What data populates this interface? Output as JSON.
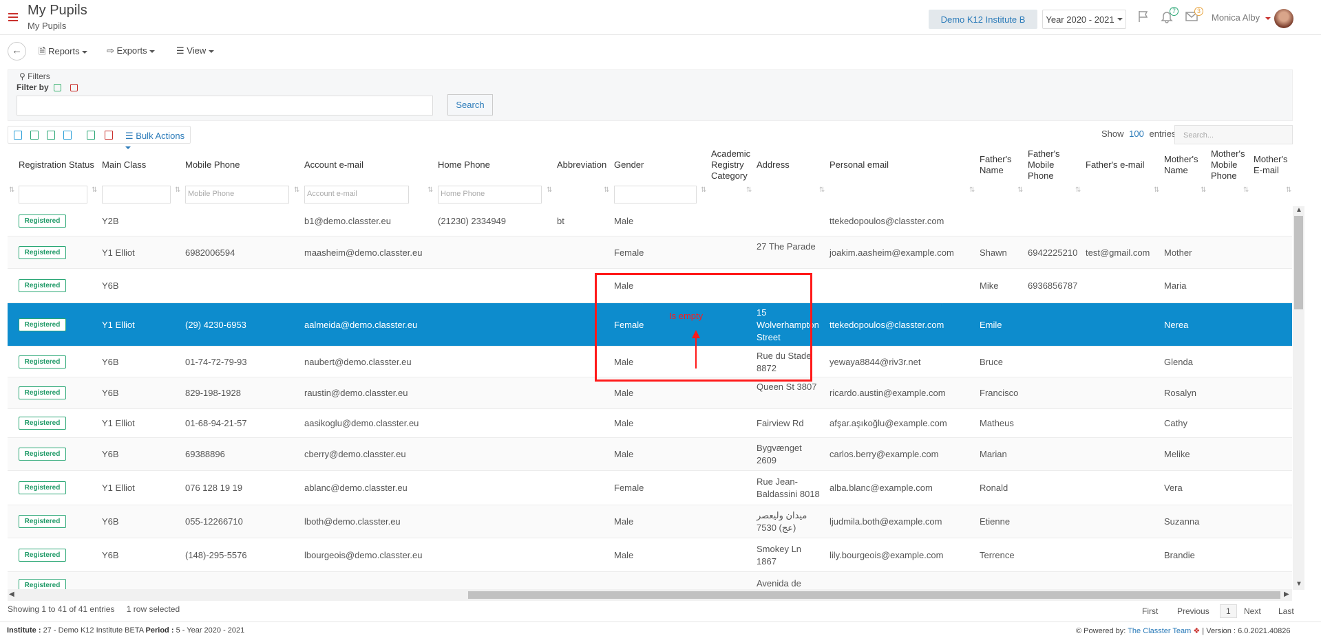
{
  "header": {
    "title": "My Pupils",
    "subtitle": "My Pupils",
    "institute": "Demo K12 Institute B",
    "year": "Year 2020 - 2021",
    "notifications_count": "7",
    "messages_count": "3",
    "user_name": "Monica Alby"
  },
  "toolbar": {
    "reports": "Reports",
    "exports": "Exports",
    "view": "View"
  },
  "filters": {
    "label": "Filters",
    "filter_by": "Filter by",
    "search_button": "Search"
  },
  "table_controls": {
    "bulk_actions": "Bulk Actions",
    "show_label": "Show",
    "entries_value": "100",
    "entries_label": "entries",
    "search_placeholder": "Search..."
  },
  "columns": {
    "registration_status": "Registration Status",
    "main_class": "Main Class",
    "mobile_phone": "Mobile Phone",
    "account_email": "Account e-mail",
    "home_phone": "Home Phone",
    "abbreviation": "Abbreviation",
    "gender": "Gender",
    "academic_registry_category": "Academic Registry Category",
    "address": "Address",
    "personal_email": "Personal email",
    "fathers_name": "Father's Name",
    "fathers_mobile_phone": "Father's Mobile Phone",
    "fathers_email": "Father's e-mail",
    "mothers_name": "Mother's Name",
    "mothers_mobile_phone": "Mother's Mobile Phone",
    "mothers_email": "Mother's E-mail"
  },
  "column_filters": {
    "mobile_phone_placeholder": "Mobile Phone",
    "account_email_placeholder": "Account e-mail",
    "home_phone_placeholder": "Home Phone"
  },
  "rows": [
    {
      "status": "Registered",
      "main_class": "Y2B",
      "mobile": "",
      "email": "b1@demo.classter.eu",
      "home_phone": "(21230) 2334949",
      "abbr": "bt",
      "gender": "Male",
      "address": "",
      "personal_email": "ttekedopoulos@classter.com",
      "father": "",
      "father_mobile": "",
      "father_email": "",
      "mother": ""
    },
    {
      "status": "Registered",
      "main_class": "Y1 Elliot",
      "mobile": "6982006594",
      "email": "maasheim@demo.classter.eu",
      "home_phone": "",
      "abbr": "",
      "gender": "Female",
      "address": "27 The Parade",
      "personal_email": "joakim.aasheim@example.com",
      "father": "Shawn",
      "father_mobile": "6942225210",
      "father_email": "test@gmail.com",
      "mother": "Mother"
    },
    {
      "status": "Registered",
      "main_class": "Y6B",
      "mobile": "",
      "email": "",
      "home_phone": "",
      "abbr": "",
      "gender": "Male",
      "address": "",
      "personal_email": "",
      "father": "Mike",
      "father_mobile": "6936856787",
      "father_email": "",
      "mother": "Maria"
    },
    {
      "status": "Registered",
      "main_class": "Y1 Elliot",
      "mobile": "(29) 4230-6953",
      "email": "aalmeida@demo.classter.eu",
      "home_phone": "",
      "abbr": "",
      "gender": "Female",
      "address": "15 Wolverhampton Street",
      "personal_email": "ttekedopoulos@classter.com",
      "father": "Emile",
      "father_mobile": "",
      "father_email": "",
      "mother": "Nerea"
    },
    {
      "status": "Registered",
      "main_class": "Y6B",
      "mobile": "01-74-72-79-93",
      "email": "naubert@demo.classter.eu",
      "home_phone": "",
      "abbr": "",
      "gender": "Male",
      "address": "Rue du Stade 8872",
      "personal_email": "yewaya8844@riv3r.net",
      "father": "Bruce",
      "father_mobile": "",
      "father_email": "",
      "mother": "Glenda"
    },
    {
      "status": "Registered",
      "main_class": "Y6B",
      "mobile": "829-198-1928",
      "email": "raustin@demo.classter.eu",
      "home_phone": "",
      "abbr": "",
      "gender": "Male",
      "address": "Queen St 3807",
      "personal_email": "ricardo.austin@example.com",
      "father": "Francisco",
      "father_mobile": "",
      "father_email": "",
      "mother": "Rosalyn"
    },
    {
      "status": "Registered",
      "main_class": "Y1 Elliot",
      "mobile": "01-68-94-21-57",
      "email": "aasikoglu@demo.classter.eu",
      "home_phone": "",
      "abbr": "",
      "gender": "Male",
      "address": "Fairview Rd",
      "personal_email": "afşar.aşıkoğlu@example.com",
      "father": "Matheus",
      "father_mobile": "",
      "father_email": "",
      "mother": "Cathy"
    },
    {
      "status": "Registered",
      "main_class": "Y6B",
      "mobile": "69388896",
      "email": "cberry@demo.classter.eu",
      "home_phone": "",
      "abbr": "",
      "gender": "Male",
      "address": "Bygvænget 2609",
      "personal_email": "carlos.berry@example.com",
      "father": "Marian",
      "father_mobile": "",
      "father_email": "",
      "mother": "Melike"
    },
    {
      "status": "Registered",
      "main_class": "Y1 Elliot",
      "mobile": "076 128 19 19",
      "email": "ablanc@demo.classter.eu",
      "home_phone": "",
      "abbr": "",
      "gender": "Female",
      "address": "Rue Jean-Baldassini 8018",
      "personal_email": "alba.blanc@example.com",
      "father": "Ronald",
      "father_mobile": "",
      "father_email": "",
      "mother": "Vera"
    },
    {
      "status": "Registered",
      "main_class": "Y6B",
      "mobile": "055-12266710",
      "email": "lboth@demo.classter.eu",
      "home_phone": "",
      "abbr": "",
      "gender": "Male",
      "address": "میدان ولیعصر (عج) 7530",
      "personal_email": "ljudmila.both@example.com",
      "father": "Etienne",
      "father_mobile": "",
      "father_email": "",
      "mother": "Suzanna"
    },
    {
      "status": "Registered",
      "main_class": "Y6B",
      "mobile": "(148)-295-5576",
      "email": "lbourgeois@demo.classter.eu",
      "home_phone": "",
      "abbr": "",
      "gender": "Male",
      "address": "Smokey Ln 1867",
      "personal_email": "lily.bourgeois@example.com",
      "father": "Terrence",
      "father_mobile": "",
      "father_email": "",
      "mother": "Brandie"
    },
    {
      "status": "Registered",
      "main_class": "",
      "mobile": "",
      "email": "",
      "home_phone": "",
      "abbr": "",
      "gender": "",
      "address": "Avenida de",
      "personal_email": "",
      "father": "",
      "father_mobile": "",
      "father_email": "",
      "mother": ""
    }
  ],
  "annotation": {
    "text": "Is empty",
    "color": "#ff1a1a"
  },
  "footer": {
    "showing": "Showing 1 to 41 of 41 entries",
    "selected": "1 row selected",
    "pager": {
      "first": "First",
      "previous": "Previous",
      "current": "1",
      "next": "Next",
      "last": "Last"
    }
  },
  "statusbar": {
    "institute_label": "Institute :",
    "institute_value": "27 - Demo K12 Institute BETA",
    "period_label": "Period :",
    "period_value": "5 - Year 2020 - 2021",
    "powered_by": "Powered by:",
    "powered_link": "The Classter Team",
    "version": "| Version : 6.0.2021.40826"
  },
  "colors": {
    "accent": "#2b7bb9",
    "selected_row": "#0d8ccd",
    "registered": "#1f9a67",
    "danger": "#c9302c"
  }
}
